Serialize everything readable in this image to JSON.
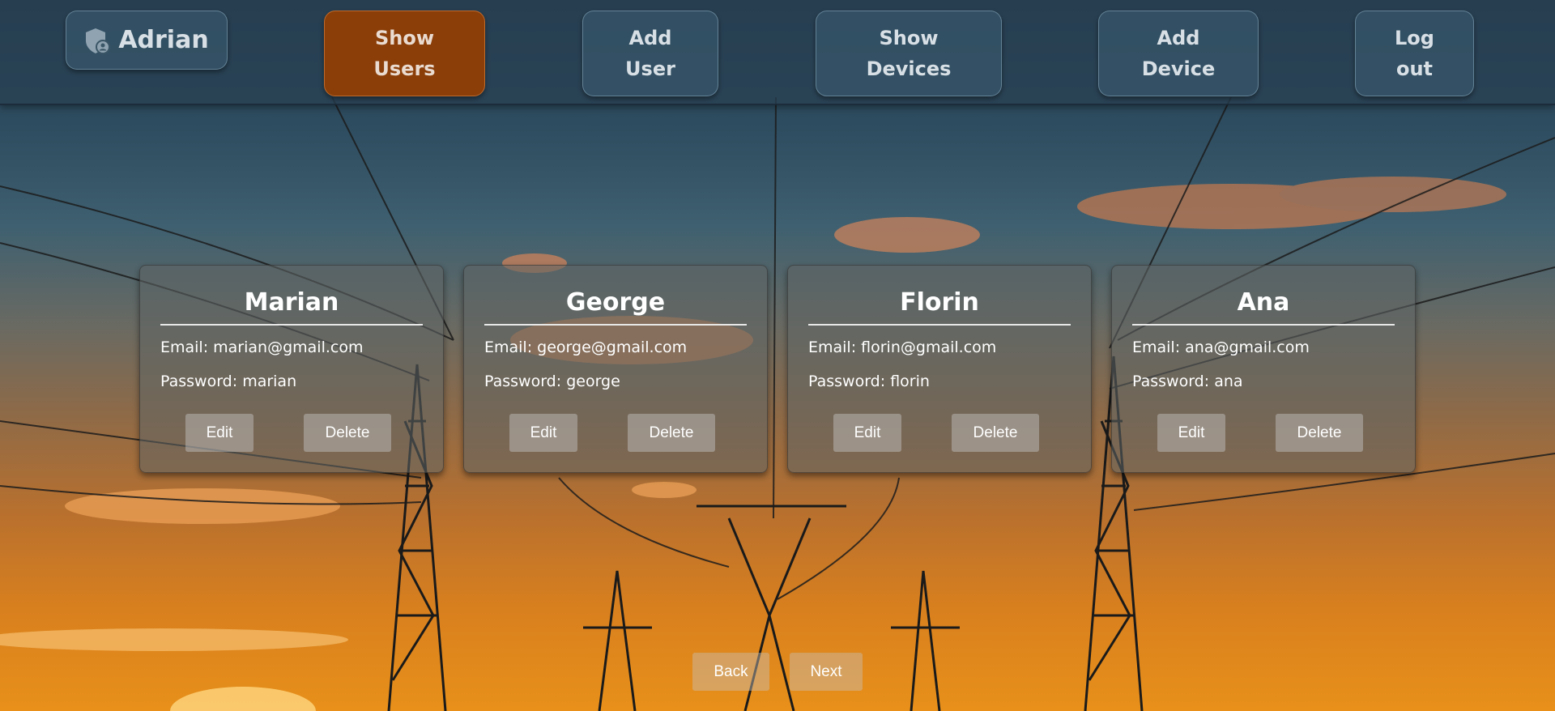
{
  "nav": {
    "brand": "Adrian",
    "items": [
      {
        "label": "Show\nUsers",
        "active": true
      },
      {
        "label": "Add\nUser",
        "active": false
      },
      {
        "label": "Show\nDevices",
        "active": false
      },
      {
        "label": "Add\nDevice",
        "active": false
      },
      {
        "label": "Log\nout",
        "active": false
      }
    ]
  },
  "users": [
    {
      "name": "Marian",
      "email": "Email: marian@gmail.com",
      "password": "Password: marian",
      "edit": "Edit",
      "delete": "Delete"
    },
    {
      "name": "George",
      "email": "Email: george@gmail.com",
      "password": "Password: george",
      "edit": "Edit",
      "delete": "Delete"
    },
    {
      "name": "Florin",
      "email": "Email: florin@gmail.com",
      "password": "Password: florin",
      "edit": "Edit",
      "delete": "Delete"
    },
    {
      "name": "Ana",
      "email": "Email: ana@gmail.com",
      "password": "Password: ana",
      "edit": "Edit",
      "delete": "Delete"
    }
  ],
  "pager": {
    "back": "Back",
    "next": "Next"
  }
}
